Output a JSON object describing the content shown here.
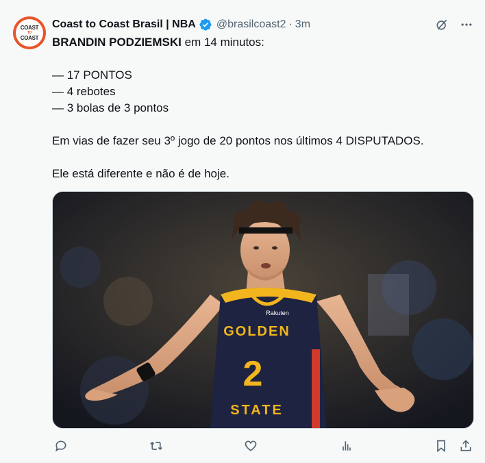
{
  "author": {
    "display_name": "Coast to Coast Brasil | NBA",
    "handle": "@brasilcoast2",
    "separator": "·",
    "time": "3m",
    "avatar_text": [
      "COAST",
      "TO",
      "COAST"
    ]
  },
  "tweet": {
    "line1_bold": "BRANDIN PODZIEMSKI",
    "line1_rest": " em 14 minutos:",
    "stats": [
      "— 17 PONTOS",
      "— 4 rebotes",
      "— 3 bolas de 3 pontos"
    ],
    "line2": "Em vias de fazer seu 3º jogo de 20 pontos nos últimos 4 DISPUTADOS.",
    "line3": "Ele está diferente e não é de hoje."
  },
  "media": {
    "jersey_top": "GOLDEN",
    "jersey_number": "2",
    "jersey_bottom": "STATE",
    "sponsor": "Rakuten"
  },
  "icons": {
    "verified": "verified-badge-icon",
    "grok": "grok-icon",
    "more": "more-icon",
    "reply": "reply-icon",
    "retweet": "retweet-icon",
    "like": "like-icon",
    "views": "views-icon",
    "bookmark": "bookmark-icon",
    "share": "share-icon"
  },
  "colors": {
    "text": "#0f1419",
    "secondary": "#536471",
    "verified": "#1d9bf0",
    "action_icon": "#536471",
    "background": "#f7f9f9",
    "avatar": "#e8552a",
    "jersey_navy": "#1d2340",
    "jersey_gold": "#f2b51d"
  }
}
